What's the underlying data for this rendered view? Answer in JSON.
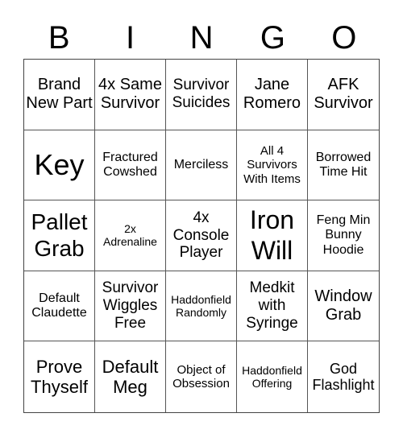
{
  "header": {
    "letters": [
      "B",
      "I",
      "N",
      "G",
      "O"
    ]
  },
  "cells": [
    "Brand New Part",
    "4x Same Survivor",
    "Survivor Suicides",
    "Jane Romero",
    "AFK Survivor",
    "Key",
    "Fractured Cowshed",
    "Merciless",
    "All 4 Survivors With Items",
    "Borrowed Time Hit",
    "Pallet Grab",
    "2x Adrenaline",
    "4x Console Player",
    "Iron Will",
    "Feng Min Bunny Hoodie",
    "Default Claudette",
    "Survivor Wiggles Free",
    "Haddonfield Randomly",
    "Medkit with Syringe",
    "Window Grab",
    "Prove Thyself",
    "Default Meg",
    "Object of Obsession",
    "Haddonfield Offering",
    "God Flashlight"
  ]
}
